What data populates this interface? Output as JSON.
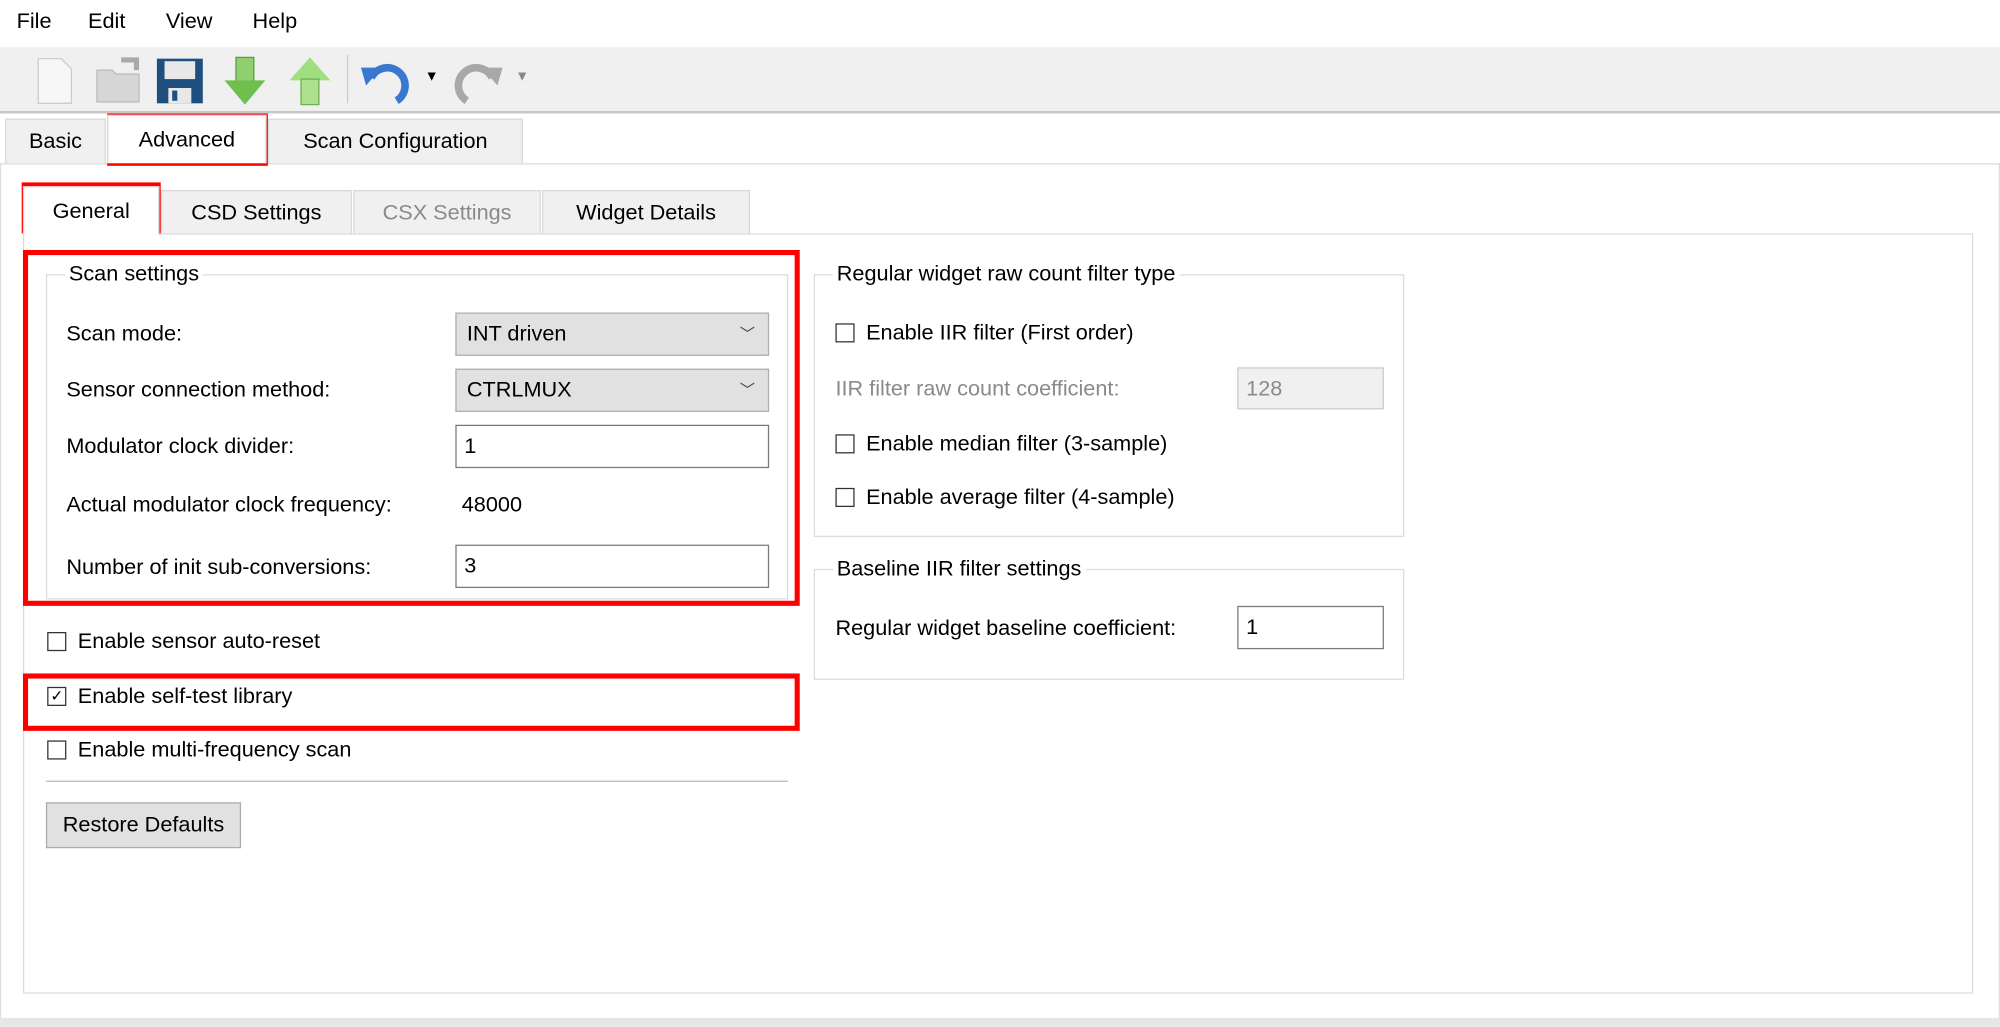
{
  "menu": [
    "File",
    "Edit",
    "View",
    "Help"
  ],
  "toolbar": {
    "icons": [
      "new-file-icon",
      "open-folder-icon",
      "save-icon",
      "import-arrow-down-icon",
      "export-arrow-up-icon",
      "undo-icon",
      "redo-icon"
    ]
  },
  "tabs": [
    {
      "label": "Basic"
    },
    {
      "label": "Advanced",
      "selected": true
    },
    {
      "label": "Scan Configuration"
    }
  ],
  "subtabs": [
    {
      "label": "General",
      "selected": true
    },
    {
      "label": "CSD Settings"
    },
    {
      "label": "CSX Settings",
      "disabled": true
    },
    {
      "label": "Widget Details"
    }
  ],
  "scan_settings": {
    "title": "Scan settings",
    "scan_mode_label": "Scan mode:",
    "scan_mode_value": "INT driven",
    "sensor_conn_label": "Sensor connection method:",
    "sensor_conn_value": "CTRLMUX",
    "mod_div_label": "Modulator clock divider:",
    "mod_div_value": "1",
    "actual_freq_label": "Actual modulator clock frequency:",
    "actual_freq_value": "48000",
    "init_sub_label": "Number of init sub-conversions:",
    "init_sub_value": "3"
  },
  "options": [
    {
      "label": "Enable sensor auto-reset",
      "checked": false
    },
    {
      "label": "Enable self-test library",
      "checked": true
    },
    {
      "label": "Enable multi-frequency scan",
      "checked": false
    }
  ],
  "restore_label": "Restore Defaults",
  "filter_group": {
    "title": "Regular widget raw count filter type",
    "iir_label": "Enable IIR filter (First order)",
    "iir_coef_label": "IIR filter raw count coefficient:",
    "iir_coef_value": "128",
    "median_label": "Enable median filter (3-sample)",
    "average_label": "Enable average filter (4-sample)"
  },
  "baseline_group": {
    "title": "Baseline IIR filter settings",
    "coef_label": "Regular widget baseline coefficient:",
    "coef_value": "1"
  },
  "colors": {
    "highlight": "#ff0000"
  }
}
